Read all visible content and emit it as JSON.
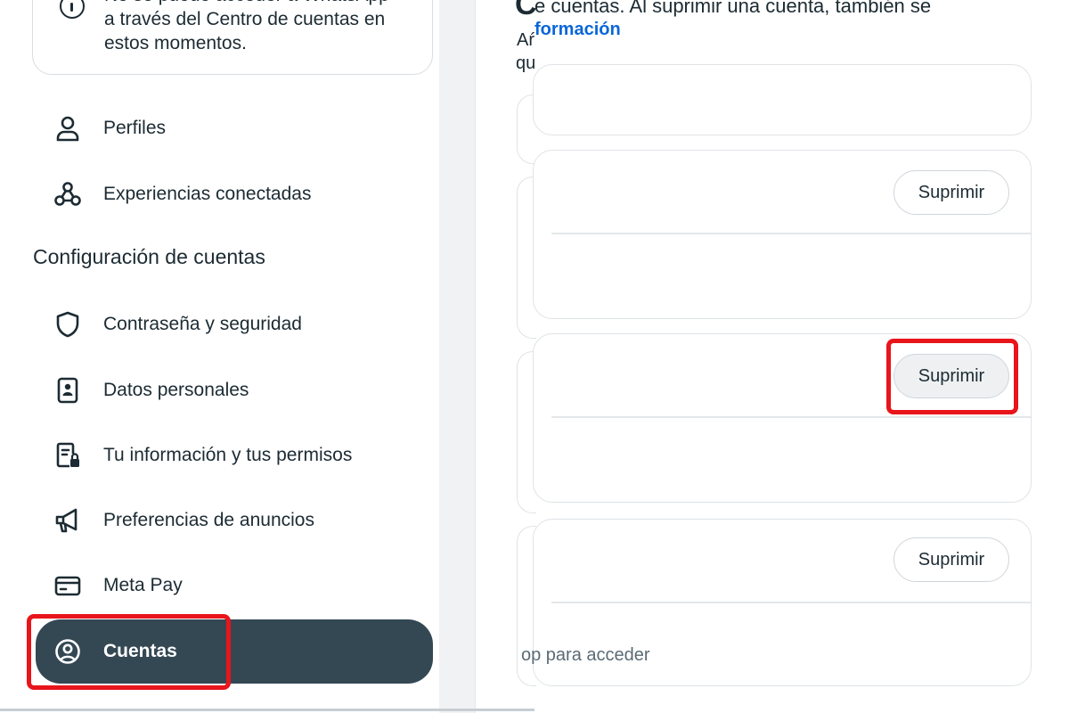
{
  "sidebar": {
    "info_lines": [
      "No se puede acceder a WhatsApp",
      "a través del Centro de cuentas en",
      "estos momentos."
    ],
    "items_top": [
      {
        "label": "Perfiles",
        "icon": "profile-icon"
      },
      {
        "label": "Experiencias conectadas",
        "icon": "connected-experiences-icon"
      }
    ],
    "section_title": "Configuración de cuentas",
    "items": [
      {
        "label": "Contraseña y seguridad",
        "icon": "shield-icon"
      },
      {
        "label": "Datos personales",
        "icon": "id-card-icon"
      },
      {
        "label": "Tu información y tus permisos",
        "icon": "document-lock-icon"
      },
      {
        "label": "Preferencias de anuncios",
        "icon": "megaphone-icon"
      },
      {
        "label": "Meta Pay",
        "icon": "credit-card-icon"
      },
      {
        "label": "Cuentas",
        "icon": "account-circle-icon",
        "active": true
      }
    ]
  },
  "main": {
    "ghost_c": "C",
    "description": "e cuentas. Al suprimir una cuenta, también se",
    "ghost_af": "Aŕ",
    "ghost_qu": "qu",
    "more_link": "formación",
    "delete_label": "Suprimir",
    "footer_fragment": "op para acceder"
  },
  "colors": {
    "active_bg": "#344854",
    "highlight": "#e8151b",
    "link": "#0a66d8"
  }
}
